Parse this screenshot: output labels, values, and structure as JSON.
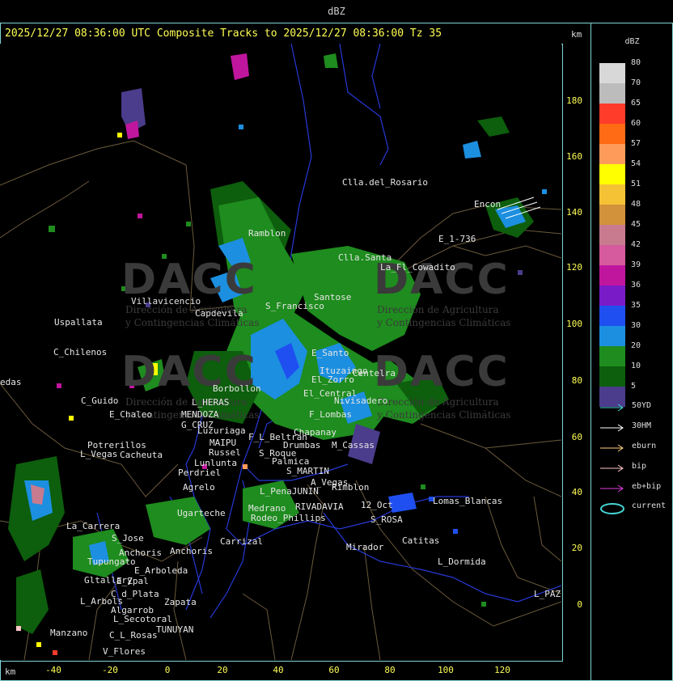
{
  "top_title": "dBZ",
  "header": "2025/12/27 08:36:00 UTC Composite Tracks to 2025/12/27 08:36:00 Tz 35",
  "km_label": "km",
  "y_ticks": [
    "180",
    "160",
    "140",
    "120",
    "100",
    "80",
    "60",
    "40",
    "20",
    "0"
  ],
  "x_ticks": [
    "-40",
    "-20",
    "0",
    "20",
    "40",
    "60",
    "80",
    "100",
    "120"
  ],
  "watermark": {
    "logo": "DACC",
    "subtitle_1": "Dirección de Agricultura",
    "subtitle_2": "y Contingencias Climáticas"
  },
  "places": [
    "Clla.del_Rosario",
    "Encon",
    "E_1-736",
    "Ramblon",
    "Clla.Santa",
    "La_Fl_Cowadito",
    "Villavicencio",
    "Capdevila",
    "S_Francisco",
    "Santose",
    "Uspallata",
    "C_Chilenos",
    "edas",
    "E_Santo",
    "Borbollon",
    "El_Central",
    "Nivisadero",
    "C_Guido",
    "L_HERAS",
    "E_Chaleo",
    "MENDOZA",
    "G_CRUZ",
    "Luzuriaga",
    "F_Lombas",
    "F_L_Beltran",
    "Chapanay",
    "Potrerillos",
    "Cacheuta",
    "L_Vegas",
    "MAIPU",
    "Russel",
    "Lunlunta",
    "Drumbas",
    "M_Cassas",
    "S_Roque",
    "Palmica",
    "Perdriel",
    "S_MARTIN",
    "A_Vegas",
    "Rimblon",
    "Agrelo",
    "L_PenaJUNIN",
    "Ugarteche",
    "12_Oct",
    "Lomas_Blancas",
    "Anchoris",
    "La_Carrera",
    "S_Jose",
    "Carrizal",
    "Medrano",
    "Rodeo_Phillips",
    "RIVADAVIA",
    "S_ROSA",
    "Catitas",
    "Tupungato",
    "Anchoris",
    "Mirador",
    "L_Dormida",
    "E_Arboleda",
    "Gltallary",
    "E_Zpal",
    "C_d_Plata",
    "L_Arbols",
    "Zapata",
    "Algarrob",
    "L_Secotoral",
    "TUNUYAN",
    "Manzano",
    "C_L_Rosas",
    "V_Flores",
    "L_PAZ",
    "Ituzaingo",
    "Centelra",
    "El_Zorro"
  ],
  "legend": {
    "title": "dBZ",
    "bins": [
      {
        "label": "80",
        "color": "#d8d8d8"
      },
      {
        "label": "70",
        "color": "#bcbcbc"
      },
      {
        "label": "65",
        "color": "#ff3b2a"
      },
      {
        "label": "60",
        "color": "#ff6a14"
      },
      {
        "label": "57",
        "color": "#ff9b5a"
      },
      {
        "label": "54",
        "color": "#ffff00"
      },
      {
        "label": "51",
        "color": "#f5c236"
      },
      {
        "label": "48",
        "color": "#d2913b"
      },
      {
        "label": "45",
        "color": "#c87b8f"
      },
      {
        "label": "42",
        "color": "#d65a9e"
      },
      {
        "label": "39",
        "color": "#c0169e"
      },
      {
        "label": "36",
        "color": "#7a1bc8"
      },
      {
        "label": "35",
        "color": "#1f4ff0"
      },
      {
        "label": "30",
        "color": "#1c8fe0"
      },
      {
        "label": "20",
        "color": "#1e8c1e"
      },
      {
        "label": "10",
        "color": "#0d5e0d"
      },
      {
        "label": "5",
        "color": "#4b3c8c"
      }
    ],
    "tracks": [
      {
        "label": "50YD",
        "color": "#45d5d5"
      },
      {
        "label": "30HM",
        "color": "#ffffff"
      },
      {
        "label": "eburn",
        "color": "#ffd27a"
      },
      {
        "label": "bip",
        "color": "#ffc8c8"
      },
      {
        "label": "eb+bip",
        "color": "#e040e0"
      }
    ],
    "current_label": "current",
    "current_color": "#45d5d5"
  }
}
